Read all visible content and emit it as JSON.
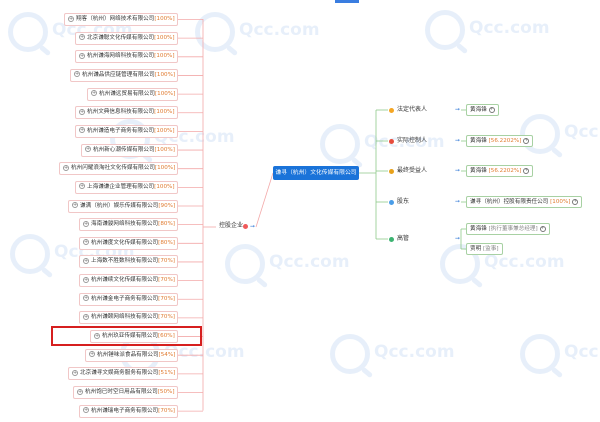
{
  "watermark": {
    "text": "Qcc.com"
  },
  "left_companies": [
    {
      "name": "翔客（杭州）网络技术有限公司",
      "pct": "[100%]"
    },
    {
      "name": "北京谦聪文化传媒有限公司",
      "pct": "[100%]"
    },
    {
      "name": "杭州谦海网络科技有限公司",
      "pct": "[100%]"
    },
    {
      "name": "杭州谦品供应链管理有限公司",
      "pct": "[100%]"
    },
    {
      "name": "杭州谦远贸易有限公司",
      "pct": "[100%]"
    },
    {
      "name": "杭州文典信息科技有限公司",
      "pct": "[100%]"
    },
    {
      "name": "杭州谦造电子商务有限公司",
      "pct": "[100%]"
    },
    {
      "name": "杭州新心潮传媒有限公司",
      "pct": "[100%]"
    },
    {
      "name": "杭州闪耀浪淘社文化传媒有限公司",
      "pct": "[100%]"
    },
    {
      "name": "上海谦谦企业管理有限公司",
      "pct": "[100%]"
    },
    {
      "name": "谦满（杭州）娱乐传媒有限公司",
      "pct": "[90%]"
    },
    {
      "name": "海南谦骏网络科技有限公司",
      "pct": "[80%]"
    },
    {
      "name": "杭州谦度文化传媒有限公司",
      "pct": "[80%]"
    },
    {
      "name": "上海数不胜数科技有限公司",
      "pct": "[70%]"
    },
    {
      "name": "杭州谦续文化传媒有限公司",
      "pct": "[70%]"
    },
    {
      "name": "杭州谦金电子商务有限公司",
      "pct": "[70%]"
    },
    {
      "name": "杭州谦颐网络科技有限公司",
      "pct": "[70%]"
    },
    {
      "name": "杭州玖亚传媒有限公司",
      "pct": "[60%]"
    },
    {
      "name": "杭州锤味派食品有限公司",
      "pct": "[54%]"
    },
    {
      "name": "北京谦寻文娱商务服务有限公司",
      "pct": "[51%]"
    },
    {
      "name": "杭州饱已时空日用品有限公司",
      "pct": "[50%]"
    },
    {
      "name": "杭州谦瑞电子商务有限公司",
      "pct": "[70%]"
    }
  ],
  "center": {
    "name": "谦寻（杭州）文化传媒有限公司",
    "left_branch_label": "控股企业"
  },
  "right_branches": [
    {
      "label": "法定代表人",
      "dot_color": "#f5a623",
      "items": [
        {
          "text": "黄海锋",
          "pct": ""
        }
      ]
    },
    {
      "label": "实际控制人",
      "dot_color": "#e74c3c",
      "items": [
        {
          "text": "黄海锋",
          "pct": "[56.2202%]"
        }
      ]
    },
    {
      "label": "最终受益人",
      "dot_color": "#e8a11a",
      "items": [
        {
          "text": "黄海锋",
          "pct": "[56.2202%]"
        }
      ]
    },
    {
      "label": "股东",
      "dot_color": "#4a9de8",
      "items": [
        {
          "text": "谦寻（杭州）控股有限责任公司",
          "pct": "[100%]"
        }
      ]
    },
    {
      "label": "高管",
      "dot_color": "#3cb371",
      "items": [
        {
          "text": "黄海锋",
          "sub": "[执行董事兼总经理]"
        },
        {
          "text": "贾明",
          "sub": "[监事]"
        }
      ]
    }
  ],
  "highlighted_company_index": 17,
  "colors": {
    "accent": "#1a73d9",
    "left_border": "#f1c7c7",
    "right_border": "#a8d1a3",
    "percent": "#e07b30",
    "highlight": "#d61f1f",
    "line_left": "#f3a9a9",
    "line_right": "#8fc98a"
  }
}
